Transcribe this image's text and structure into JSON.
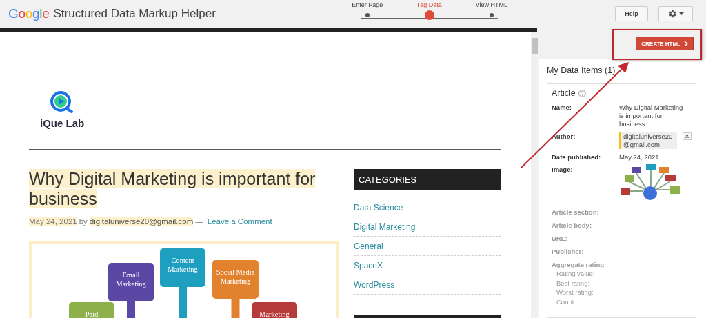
{
  "header": {
    "logo": "Google",
    "title": "Structured Data Markup Helper",
    "steps": [
      {
        "label": "Enter Page",
        "selected": false
      },
      {
        "label": "Tag Data",
        "selected": true
      },
      {
        "label": "View HTML",
        "selected": false
      }
    ],
    "help_button": "Help"
  },
  "page": {
    "site_name": "iQue Lab",
    "post": {
      "title": "Why Digital Marketing is important for business",
      "date": "May 24, 2021",
      "by": "by",
      "author": "digitaluniverse20@gmail.com",
      "separator": "—",
      "comment_link": "Leave a Comment",
      "image": {
        "nodes": [
          {
            "label": "Paid",
            "color": "#8db04a"
          },
          {
            "label": "Email Marketing",
            "color": "#5b48a4"
          },
          {
            "label": "Content Marketing",
            "color": "#1f9fc0"
          },
          {
            "label": "Social Media Marketing",
            "color": "#e2822f"
          },
          {
            "label": "Marketing",
            "color": "#b63a3a"
          }
        ]
      }
    },
    "categories": {
      "title": "CATEGORIES",
      "items": [
        "Data Science",
        "Digital Marketing",
        "General",
        "SpaceX",
        "WordPress"
      ]
    }
  },
  "panel": {
    "create_button": "CREATE HTML",
    "title": "My Data Items (1)",
    "item": {
      "type": "Article",
      "fields": [
        {
          "kind": "text",
          "label": "Name:",
          "value": "Why Digital Marketing is important for business"
        },
        {
          "kind": "highlighted",
          "label": "Author:",
          "value": "digitaluniverse20@gmail.com",
          "remove_button": "X"
        },
        {
          "kind": "text",
          "label": "Date published:",
          "value": "May 24, 2021"
        },
        {
          "label": "Image:"
        },
        {
          "kind": "empty",
          "label": "Article section:"
        },
        {
          "kind": "empty",
          "label": "Article body:"
        },
        {
          "kind": "empty",
          "label": "URL:"
        },
        {
          "kind": "empty",
          "label": "Publisher:"
        },
        {
          "kind": "group",
          "label": "Aggregate rating",
          "children": [
            "Rating value:",
            "Best rating:",
            "Worst rating:",
            "Count:"
          ]
        }
      ]
    }
  }
}
